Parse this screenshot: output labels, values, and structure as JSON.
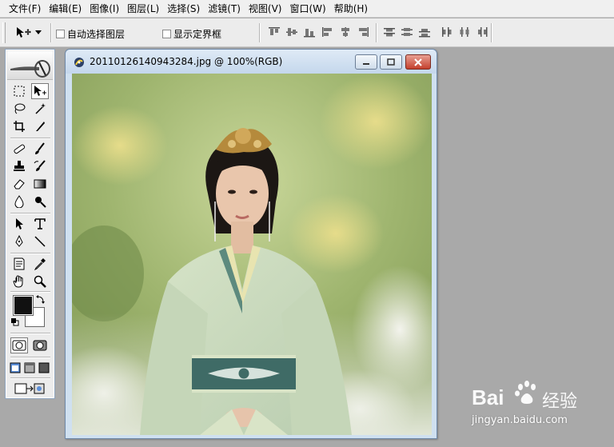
{
  "menubar": {
    "items": [
      {
        "label": "文件(F)"
      },
      {
        "label": "编辑(E)"
      },
      {
        "label": "图像(I)"
      },
      {
        "label": "图层(L)"
      },
      {
        "label": "选择(S)"
      },
      {
        "label": "滤镜(T)"
      },
      {
        "label": "视图(V)"
      },
      {
        "label": "窗口(W)"
      },
      {
        "label": "帮助(H)"
      }
    ]
  },
  "options": {
    "auto_select_label": "自动选择图层",
    "show_bounds_label": "显示定界框",
    "auto_select_checked": false,
    "show_bounds_checked": false
  },
  "document": {
    "title": "20110126140943284.jpg @ 100%(RGB)"
  },
  "toolbox": {
    "foreground_color": "#111111",
    "background_color": "#ffffff"
  },
  "watermark": {
    "logo_text": "Bai",
    "logo_text2": "经验",
    "url": "jingyan.baidu.com"
  }
}
